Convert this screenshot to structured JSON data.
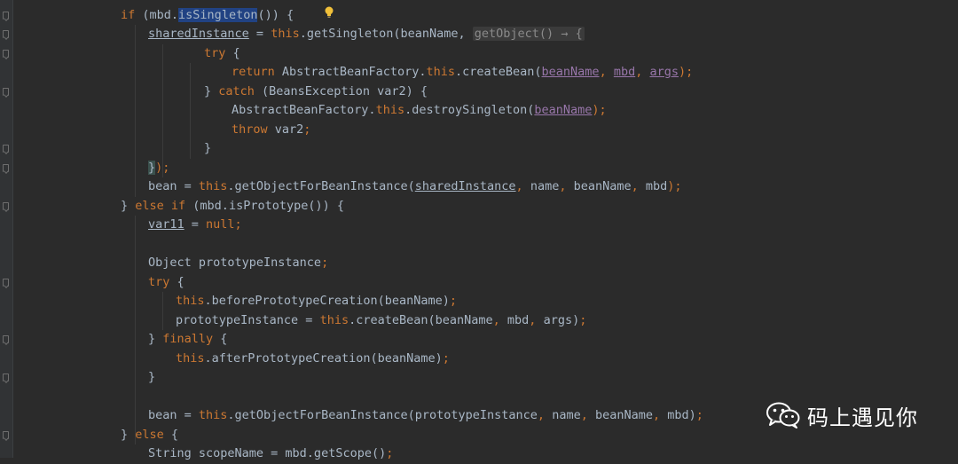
{
  "editor": {
    "lines": [
      {
        "indent": 0,
        "tokens": [
          {
            "t": "if",
            "c": "kw"
          },
          {
            "t": " (mbd."
          },
          {
            "t": "isSingleton",
            "c": "hl"
          },
          {
            "t": "()) {"
          }
        ]
      },
      {
        "indent": 1,
        "tokens": [
          {
            "t": "sharedInstance",
            "c": "uline"
          },
          {
            "t": " = "
          },
          {
            "t": "this",
            "c": "kw"
          },
          {
            "t": ".getSingleton(beanName, "
          },
          {
            "t": "getObject() → {",
            "c": "lambda-box"
          }
        ]
      },
      {
        "indent": 3,
        "tokens": [
          {
            "t": "try",
            "c": "kw"
          },
          {
            "t": " {"
          }
        ]
      },
      {
        "indent": 4,
        "tokens": [
          {
            "t": "return",
            "c": "kw"
          },
          {
            "t": " AbstractBeanFactory."
          },
          {
            "t": "this",
            "c": "kw"
          },
          {
            "t": ".createBean("
          },
          {
            "t": "beanName",
            "c": "uvar"
          },
          {
            "t": ", ",
            "c": "kw"
          },
          {
            "t": "mbd",
            "c": "uvar"
          },
          {
            "t": ", ",
            "c": "kw"
          },
          {
            "t": "args",
            "c": "uvar"
          },
          {
            "t": ");",
            "c": "kw"
          }
        ]
      },
      {
        "indent": 3,
        "tokens": [
          {
            "t": "} "
          },
          {
            "t": "catch",
            "c": "kw"
          },
          {
            "t": " (BeansException var2) {"
          }
        ]
      },
      {
        "indent": 4,
        "tokens": [
          {
            "t": "AbstractBeanFactory."
          },
          {
            "t": "this",
            "c": "kw"
          },
          {
            "t": ".destroySingleton("
          },
          {
            "t": "beanName",
            "c": "uvar"
          },
          {
            "t": ");",
            "c": "kw"
          }
        ]
      },
      {
        "indent": 4,
        "tokens": [
          {
            "t": "throw",
            "c": "kw"
          },
          {
            "t": " var2"
          },
          {
            "t": ";",
            "c": "kw"
          }
        ]
      },
      {
        "indent": 3,
        "tokens": [
          {
            "t": "}"
          }
        ]
      },
      {
        "indent": 1,
        "tokens": [
          {
            "t": "}",
            "c": "bracket-hl"
          },
          {
            "t": ");",
            "c": "kw"
          }
        ]
      },
      {
        "indent": 1,
        "tokens": [
          {
            "t": "bean = "
          },
          {
            "t": "this",
            "c": "kw"
          },
          {
            "t": ".getObjectForBeanInstance("
          },
          {
            "t": "sharedInstance",
            "c": "uline"
          },
          {
            "t": ", ",
            "c": "kw"
          },
          {
            "t": "name"
          },
          {
            "t": ", ",
            "c": "kw"
          },
          {
            "t": "beanName"
          },
          {
            "t": ", ",
            "c": "kw"
          },
          {
            "t": "mbd"
          },
          {
            "t": ");",
            "c": "kw"
          }
        ]
      },
      {
        "indent": 0,
        "tokens": [
          {
            "t": "} "
          },
          {
            "t": "else if",
            "c": "kw"
          },
          {
            "t": " (mbd.isPrototype()) {"
          }
        ]
      },
      {
        "indent": 1,
        "tokens": [
          {
            "t": "var11",
            "c": "uline"
          },
          {
            "t": " = "
          },
          {
            "t": "null",
            "c": "kw"
          },
          {
            "t": ";",
            "c": "kw"
          }
        ]
      },
      {
        "indent": 1,
        "tokens": []
      },
      {
        "indent": 1,
        "tokens": [
          {
            "t": "Object prototypeInstance"
          },
          {
            "t": ";",
            "c": "kw"
          }
        ]
      },
      {
        "indent": 1,
        "tokens": [
          {
            "t": "try",
            "c": "kw"
          },
          {
            "t": " {"
          }
        ]
      },
      {
        "indent": 2,
        "tokens": [
          {
            "t": "this",
            "c": "kw"
          },
          {
            "t": ".beforePrototypeCreation(beanName)"
          },
          {
            "t": ";",
            "c": "kw"
          }
        ]
      },
      {
        "indent": 2,
        "tokens": [
          {
            "t": "prototypeInstance = "
          },
          {
            "t": "this",
            "c": "kw"
          },
          {
            "t": ".createBean(beanName"
          },
          {
            "t": ", ",
            "c": "kw"
          },
          {
            "t": "mbd"
          },
          {
            "t": ", ",
            "c": "kw"
          },
          {
            "t": "args)"
          },
          {
            "t": ";",
            "c": "kw"
          }
        ]
      },
      {
        "indent": 1,
        "tokens": [
          {
            "t": "} "
          },
          {
            "t": "finally",
            "c": "kw"
          },
          {
            "t": " {"
          }
        ]
      },
      {
        "indent": 2,
        "tokens": [
          {
            "t": "this",
            "c": "kw"
          },
          {
            "t": ".afterPrototypeCreation(beanName)"
          },
          {
            "t": ";",
            "c": "kw"
          }
        ]
      },
      {
        "indent": 1,
        "tokens": [
          {
            "t": "}"
          }
        ]
      },
      {
        "indent": 1,
        "tokens": []
      },
      {
        "indent": 1,
        "tokens": [
          {
            "t": "bean = "
          },
          {
            "t": "this",
            "c": "kw"
          },
          {
            "t": ".getObjectForBeanInstance(prototypeInstance"
          },
          {
            "t": ", ",
            "c": "kw"
          },
          {
            "t": "name"
          },
          {
            "t": ", ",
            "c": "kw"
          },
          {
            "t": "beanName"
          },
          {
            "t": ", ",
            "c": "kw"
          },
          {
            "t": "mbd)"
          },
          {
            "t": ";",
            "c": "kw"
          }
        ]
      },
      {
        "indent": 0,
        "tokens": [
          {
            "t": "} "
          },
          {
            "t": "else",
            "c": "kw"
          },
          {
            "t": " {"
          }
        ]
      },
      {
        "indent": 1,
        "tokens": [
          {
            "t": "String scopeName = mbd.getScope()"
          },
          {
            "t": ";",
            "c": "kw"
          }
        ]
      }
    ]
  },
  "icons": {
    "intention": "lightbulb-icon",
    "watermark_logo": "wechat-icon"
  },
  "watermark": {
    "text": "码上遇见你"
  },
  "colors": {
    "background": "#2b2b2b",
    "keyword": "#cc7832",
    "default": "#a9b7c6",
    "field": "#9876aa",
    "selection": "#214283"
  }
}
